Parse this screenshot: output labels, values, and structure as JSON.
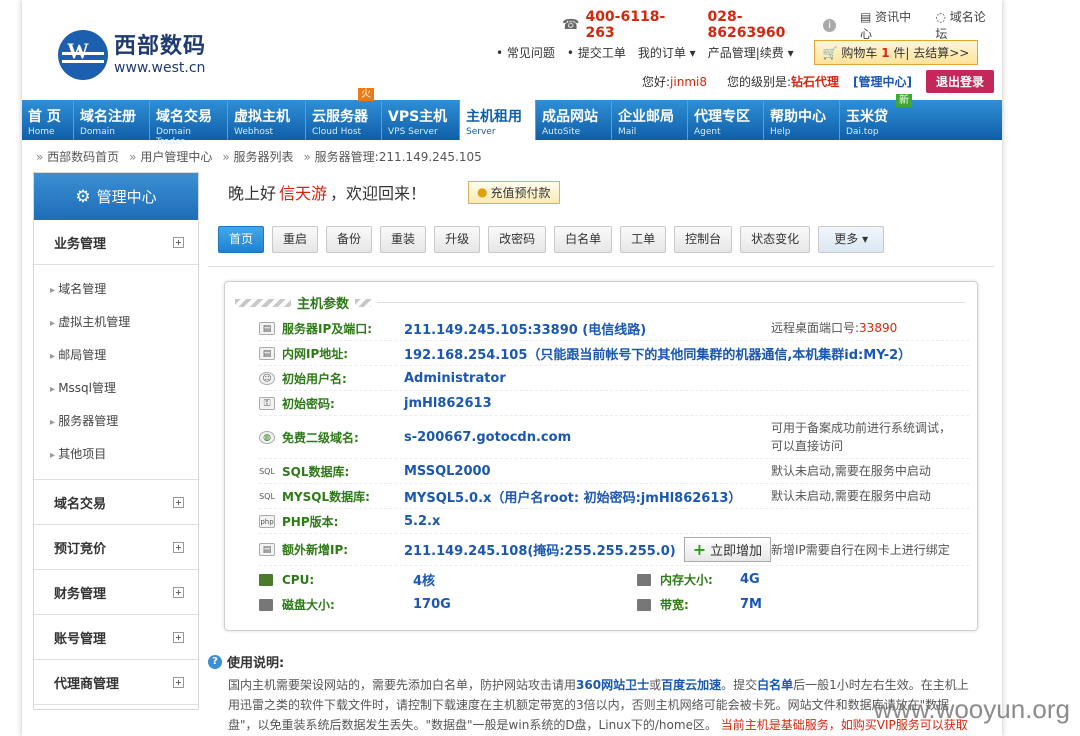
{
  "header": {
    "logo_cn": "西部数码",
    "logo_en": "www.west.cn",
    "phone1": "400-6118-263",
    "phone2": "028-86263960",
    "link_info": "资讯中心",
    "link_forum": "域名论坛",
    "links": [
      "常见问题",
      "提交工单",
      "我的订单",
      "产品管理|续费"
    ],
    "cart_label": "购物车",
    "cart_count": "1",
    "cart_suffix": "件| 去结算>>",
    "hello": "您好:",
    "username": "jinmi8",
    "level_prefix": "您的级别是:",
    "level": "钻石代理",
    "admin_center": "[管理中心]",
    "logout": "退出登录"
  },
  "nav": [
    {
      "cn": "首 页",
      "en": "Home"
    },
    {
      "cn": "域名注册",
      "en": "Domain"
    },
    {
      "cn": "域名交易",
      "en": "Domain Trader"
    },
    {
      "cn": "虚拟主机",
      "en": "Webhost"
    },
    {
      "cn": "云服务器",
      "en": "Cloud Host"
    },
    {
      "cn": "VPS主机",
      "en": "VPS Server",
      "tag": "火"
    },
    {
      "cn": "主机租用",
      "en": "Server"
    },
    {
      "cn": "成品网站",
      "en": "AutoSite"
    },
    {
      "cn": "企业邮局",
      "en": "Mail"
    },
    {
      "cn": "代理专区",
      "en": "Agent"
    },
    {
      "cn": "帮助中心",
      "en": "Help"
    },
    {
      "cn": "玉米贷",
      "en": "Dai.top",
      "tag": "新"
    }
  ],
  "breadcrumb": [
    "西部数码首页",
    "用户管理中心",
    "服务器列表",
    "服务器管理:211.149.245.105"
  ],
  "sidebar": {
    "title": "管理中心",
    "groups": [
      "业务管理",
      "域名交易",
      "预订竞价",
      "财务管理",
      "账号管理",
      "代理商管理"
    ],
    "sub_items": [
      "域名管理",
      "虚拟主机管理",
      "邮局管理",
      "Mssql管理",
      "服务器管理",
      "其他项目"
    ]
  },
  "greeting": {
    "prefix": "晚上好",
    "name": "信天游",
    "suffix": "，欢迎回来！",
    "recharge": "充值预付款"
  },
  "toolbar": [
    "首页",
    "重启",
    "备份",
    "重装",
    "升级",
    "改密码",
    "白名单",
    "工单",
    "控制台",
    "状态变化",
    "更多"
  ],
  "panel": {
    "title": "主机参数",
    "rows": [
      {
        "icon": "server-icon",
        "label": "服务器IP及端口:",
        "value": "211.149.245.105:33890  (电信线路)",
        "note_prefix": "远程桌面端口号:",
        "note_value": "33890"
      },
      {
        "icon": "server-icon",
        "label": "内网IP地址:",
        "value": "192.168.254.105（只能跟当前帐号下的其他同集群的机器通信,本机集群id:MY-2）"
      },
      {
        "icon": "user-icon",
        "label": "初始用户名:",
        "value": "Administrator"
      },
      {
        "icon": "lock-icon",
        "label": "初始密码:",
        "value": "jmHl862613"
      },
      {
        "icon": "globe-icon",
        "label": "免费二级域名:",
        "value": "s-200667.gotocdn.com",
        "note": "可用于备案成功前进行系统调试，可以直接访问"
      },
      {
        "icon": "sql-icon",
        "label": "SQL数据库:",
        "value": "MSSQL2000",
        "note": "默认未启动,需要在服务中启动"
      },
      {
        "icon": "sql-icon",
        "label": "MYSQL数据库:",
        "value": "MYSQL5.0.x（用户名root: 初始密码:jmHl862613）",
        "note": "默认未启动,需要在服务中启动"
      },
      {
        "icon": "php-icon",
        "label": "PHP版本:",
        "value": "5.2.x"
      },
      {
        "icon": "server-icon",
        "label": "额外新增IP:",
        "value": "211.149.245.108(掩码:255.255.255.0)",
        "button": "立即增加",
        "note": "新增IP需要自行在网卡上进行绑定"
      }
    ],
    "specs": [
      {
        "label": "CPU:",
        "value": "4核",
        "label2": "内存大小:",
        "value2": "4G"
      },
      {
        "label": "磁盘大小:",
        "value": "170G",
        "label2": "带宽:",
        "value2": "7M"
      }
    ]
  },
  "usage": {
    "title": "使用说明:",
    "text1": "国内主机需要架设网站的，需要先添加白名单，防护网站攻击请用",
    "link1": "360网站卫士",
    "text2": "或",
    "link2": "百度云加速",
    "text3": "。提交",
    "link3": "白名单",
    "text4": "后一般1小时左右生效。在主机上用迅雷之类的软件下载文件时，请控制下载速度在主机额定带宽的3倍以内，否则主机网络可能会被卡死。网站文件和数据库请放在\"数据盘\"，以免重装系统后数据发生丢失。\"数据盘\"一般是win系统的D盘，Linux下的/home区。",
    "notice": "当前主机是基础服务，如购买VIP服务可以获取更多技术支持。立即购买>>"
  },
  "watermark": "www.wooyun.org"
}
